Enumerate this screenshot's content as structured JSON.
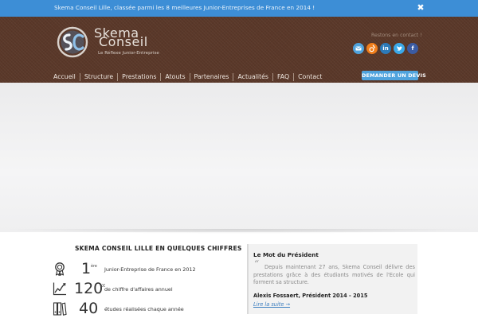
{
  "announcement": {
    "text": "Skema Conseil Lille, classée parmi les 8 meilleures Junior-Entreprises de France en 2014 !",
    "close_icon": "✖"
  },
  "brand": {
    "name_line1": "Skema",
    "name_line2": "Conseil",
    "tagline": "Le Réflexe Junior-Entreprise"
  },
  "header": {
    "contact_link": "Restons en contact !",
    "social": [
      {
        "icon": "email-icon",
        "glyph": "✉",
        "color": "#4fa3dd"
      },
      {
        "icon": "viadeo-icon",
        "glyph": "v",
        "color": "#f07d1a"
      },
      {
        "icon": "linkedin-icon",
        "glyph": "in",
        "color": "#2c7ab8"
      },
      {
        "icon": "twitter-icon",
        "glyph": "t",
        "color": "#3ca9e8"
      },
      {
        "icon": "facebook-icon",
        "glyph": "f",
        "color": "#3b5ba2"
      }
    ]
  },
  "nav": {
    "items": [
      "Accueil",
      "Structure",
      "Prestations",
      "Atouts",
      "Partenaires",
      "Actualités",
      "FAQ",
      "Contact"
    ],
    "cta_label": "DEMANDER UN DEVIS"
  },
  "figures": {
    "title": "SKEMA CONSEIL LILLE EN QUELQUES CHIFFRES",
    "items": [
      {
        "icon": "award-ribbon-icon",
        "number": "1",
        "sup": "ère",
        "label": "Junior-Entreprise de France en 2012"
      },
      {
        "icon": "growth-chart-icon",
        "number": "120",
        "sup": "K€",
        "label": "de chiffre d'affaires annuel"
      },
      {
        "icon": "binders-icon",
        "number": "40",
        "sup": "",
        "label": "études réalisées chaque année"
      }
    ]
  },
  "president": {
    "title": "Le Mot du Président",
    "quote_mark": "“",
    "text": "Depuis maintenant 27 ans, Skema Conseil délivre des prestations grâce à des étudiants motivés de l'Ecole qui forment sa structure.",
    "author": "Alexis Fossaert, Président 2014 - 2015",
    "read_more": "Lire la suite →"
  },
  "colors": {
    "topbar": "#3d8ed6",
    "header_brown": "#5a3829",
    "cta_blue": "#4fa3dd"
  }
}
